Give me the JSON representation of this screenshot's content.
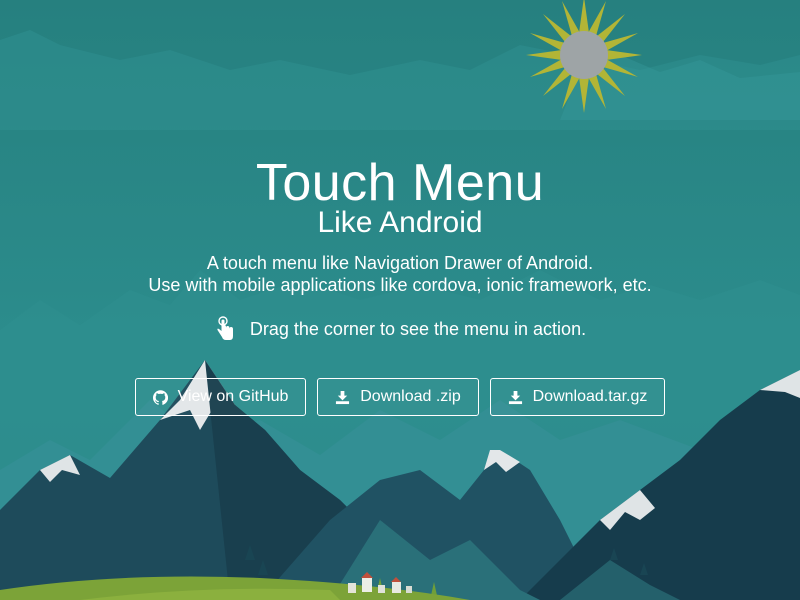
{
  "hero": {
    "title": "Touch Menu",
    "subtitle": "Like Android",
    "description_lines": [
      "A touch menu like Navigation Drawer of Android.",
      "Use with mobile applications like cordova, ionic framework, etc."
    ],
    "hint": {
      "icon": "touch-hand-icon",
      "text": "Drag the corner to see the menu in action."
    }
  },
  "buttons": [
    {
      "label": "View on GitHub",
      "icon": "github-icon"
    },
    {
      "label": "Download .zip",
      "icon": "download-icon"
    },
    {
      "label": "Download.tar.gz",
      "icon": "download-icon"
    }
  ],
  "colors": {
    "sky": "#2b8b8c",
    "sky_top": "#25807f",
    "mountain_dark": "#1d4a59",
    "mountain_mid": "#2a6d77",
    "snow": "#e3e7e9",
    "sun_ray": "#b8b83a",
    "sun_core": "#9aa2a6",
    "grass": "#7fa336",
    "text": "#ffffff"
  }
}
